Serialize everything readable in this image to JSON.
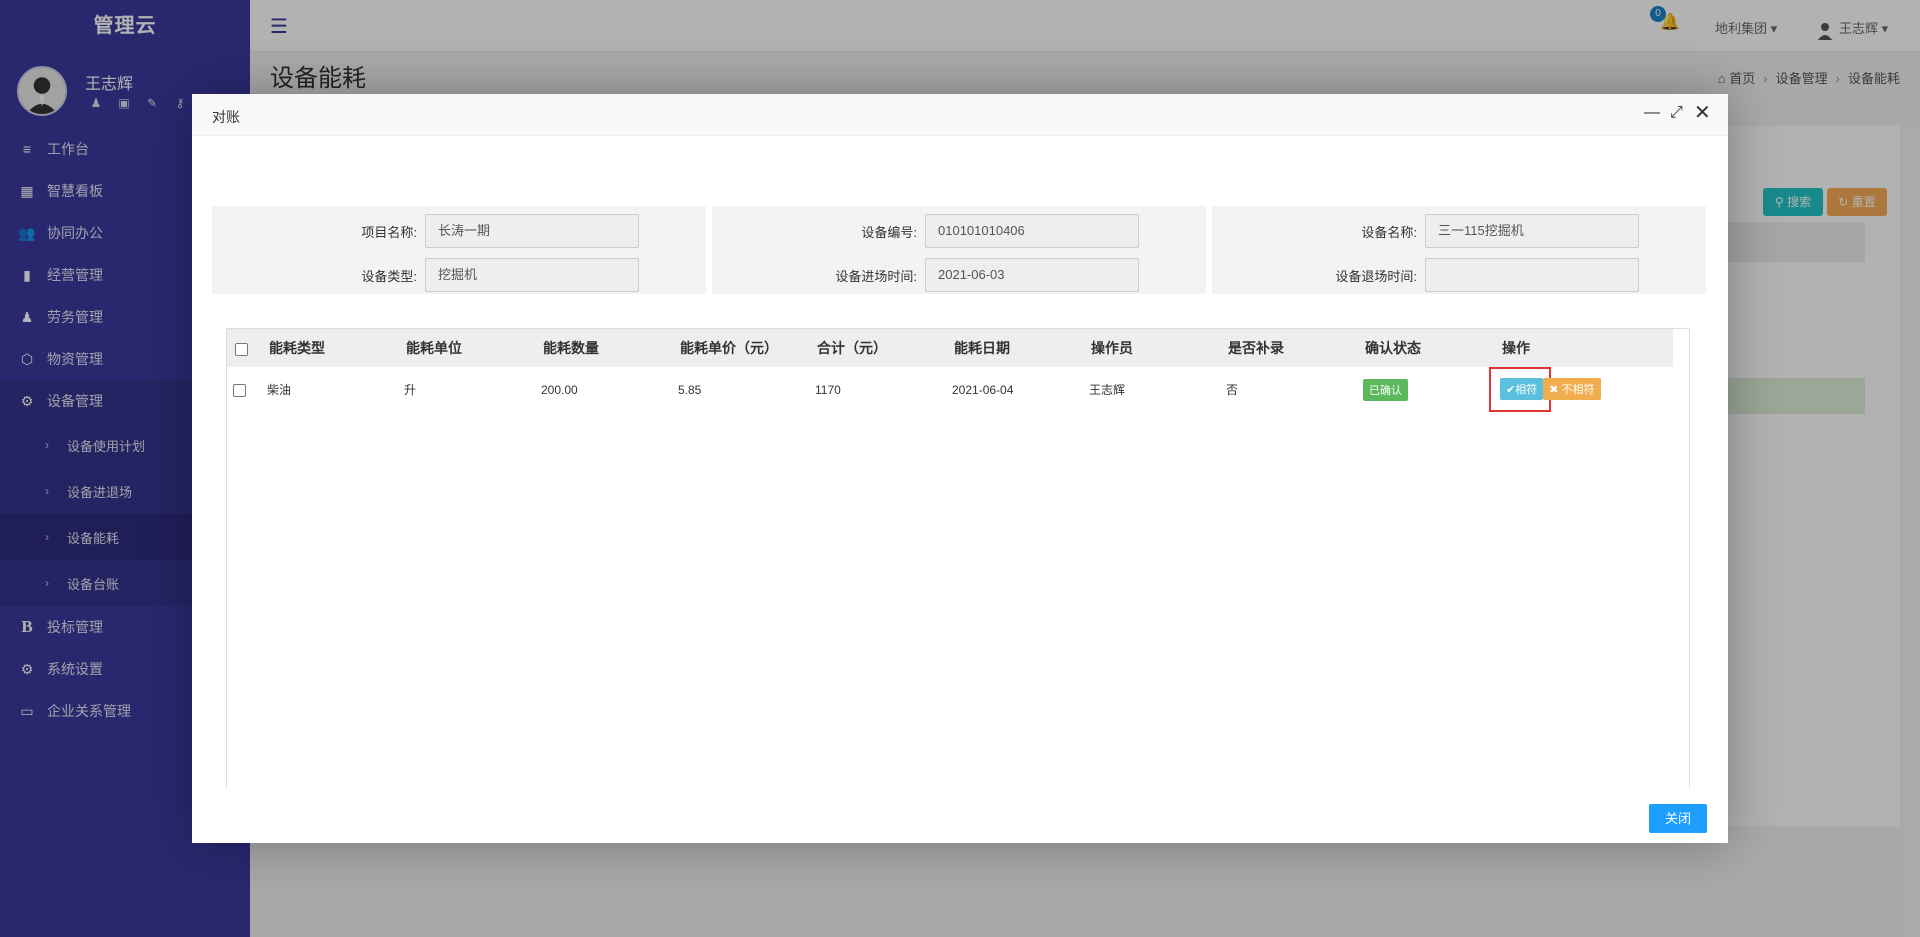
{
  "app": {
    "brand": "管理云",
    "user_name": "王志辉"
  },
  "sidebar": {
    "items": [
      {
        "icon": "≡",
        "label": "工作台"
      },
      {
        "icon": "▦",
        "label": "智慧看板"
      },
      {
        "icon": "👥",
        "label": "协同办公"
      },
      {
        "icon": "▮",
        "label": "经营管理"
      },
      {
        "icon": "♟",
        "label": "劳务管理"
      },
      {
        "icon": "⬡",
        "label": "物资管理"
      },
      {
        "icon": "⚙",
        "label": "设备管理"
      }
    ],
    "sub_items": [
      {
        "label": "设备使用计划"
      },
      {
        "label": "设备进退场"
      },
      {
        "label": "设备能耗"
      },
      {
        "label": "设备台账"
      }
    ],
    "items_after": [
      {
        "icon": "B",
        "label": "投标管理"
      },
      {
        "icon": "⚙",
        "label": "系统设置"
      },
      {
        "icon": "▭",
        "label": "企业关系管理"
      }
    ]
  },
  "topbar": {
    "notification_count": "0",
    "org_name": "地利集团",
    "user_name": "王志辉"
  },
  "page": {
    "title": "设备能耗",
    "breadcrumb": [
      "首页",
      "设备管理",
      "设备能耗"
    ],
    "search_label": "搜索",
    "reset_label": "重置"
  },
  "modal": {
    "title": "对账",
    "close_label": "关闭",
    "form": {
      "project_name_label": "项目名称:",
      "project_name_value": "长涛一期",
      "equipment_type_label": "设备类型:",
      "equipment_type_value": "挖掘机",
      "equipment_no_label": "设备编号:",
      "equipment_no_value": "010101010406",
      "entry_time_label": "设备进场时间:",
      "entry_time_value": "2021-06-03",
      "equipment_name_label": "设备名称:",
      "equipment_name_value": "三一115挖掘机",
      "exit_time_label": "设备退场时间:",
      "exit_time_value": ""
    },
    "table": {
      "headers": [
        "能耗类型",
        "能耗单位",
        "能耗数量",
        "能耗单价（元）",
        "合计（元）",
        "能耗日期",
        "操作员",
        "是否补录",
        "确认状态",
        "操作"
      ],
      "rows": [
        {
          "type": "柴油",
          "unit": "升",
          "qty": "200.00",
          "price": "5.85",
          "total": "1170",
          "date": "2021-06-04",
          "operator": "王志辉",
          "supplement": "否",
          "status": "已确认",
          "match_label": "相符",
          "nomatch_label": "不相符"
        }
      ]
    }
  }
}
